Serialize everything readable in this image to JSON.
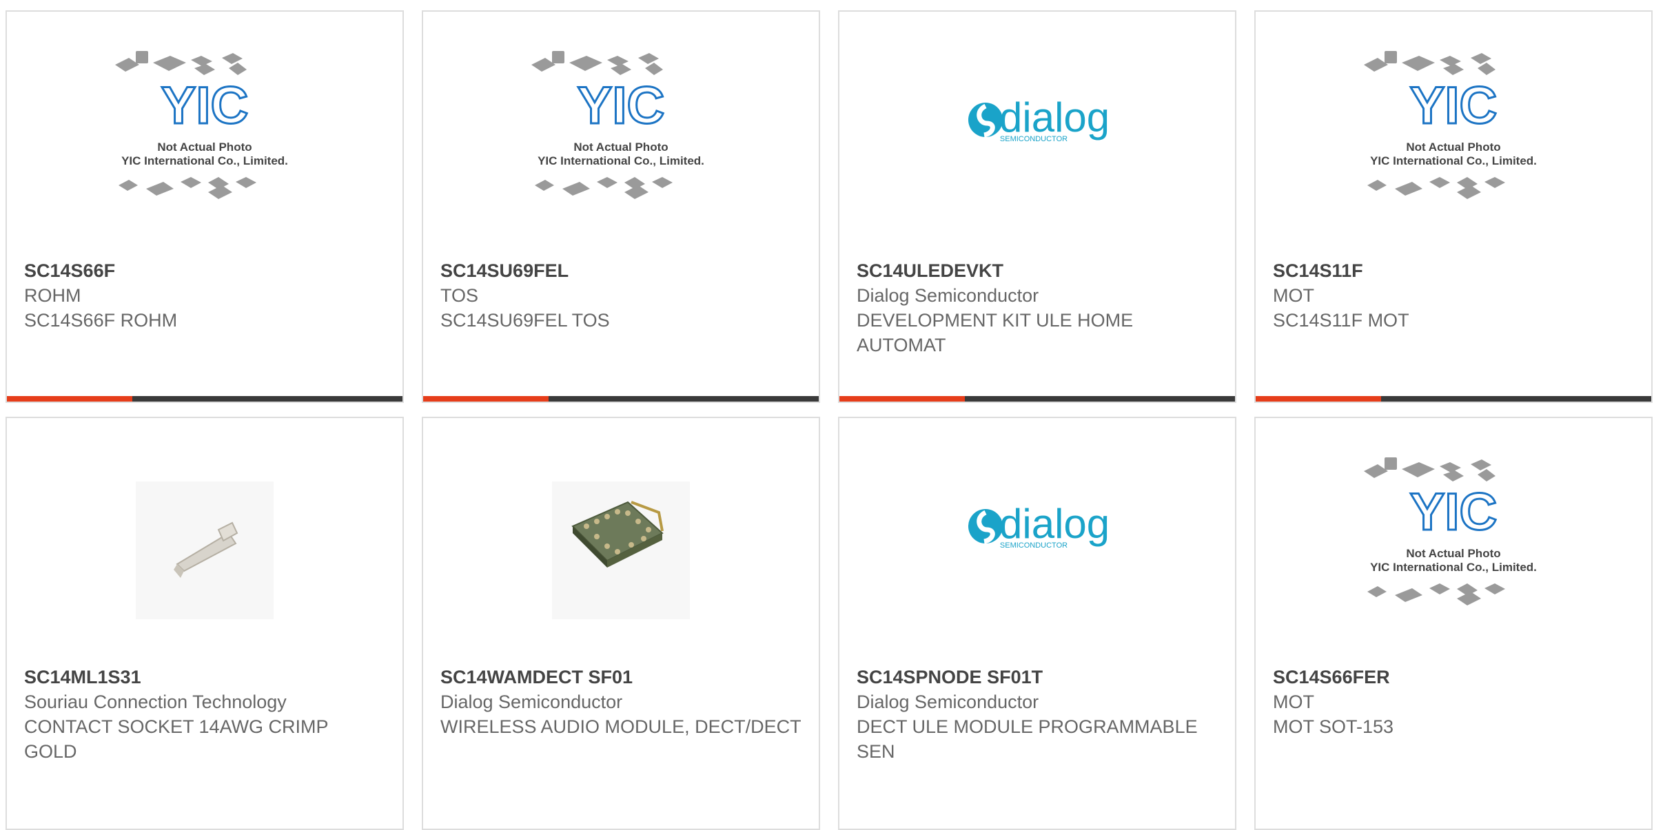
{
  "cards": [
    {
      "part": "SC14S66F",
      "maker": "ROHM",
      "desc": "SC14S66F ROHM",
      "image": "yic-placeholder-icon"
    },
    {
      "part": "SC14SU69FEL",
      "maker": "TOS",
      "desc": "SC14SU69FEL TOS",
      "image": "yic-placeholder-icon"
    },
    {
      "part": "SC14ULEDEVKT",
      "maker": "Dialog Semiconductor",
      "desc": "DEVELOPMENT KIT ULE HOME AUTOMAT",
      "image": "dialog-logo-icon"
    },
    {
      "part": "SC14S11F",
      "maker": "MOT",
      "desc": "SC14S11F MOT",
      "image": "yic-placeholder-icon"
    },
    {
      "part": "SC14ML1S31",
      "maker": "Souriau Connection Technology",
      "desc": "CONTACT SOCKET 14AWG CRIMP GOLD",
      "image": "contact-socket-icon"
    },
    {
      "part": "SC14WAMDECT SF01",
      "maker": "Dialog Semiconductor",
      "desc": "WIRELESS AUDIO MODULE, DECT/DECT",
      "image": "audio-module-icon"
    },
    {
      "part": "SC14SPNODE SF01T",
      "maker": "Dialog Semiconductor",
      "desc": "DECT ULE MODULE PROGRAMMABLE SEN",
      "image": "dialog-logo-icon"
    },
    {
      "part": "SC14S66FER",
      "maker": "MOT",
      "desc": "MOT SOT-153",
      "image": "yic-placeholder-icon"
    }
  ],
  "placeholder": {
    "brand": "YIC",
    "line1": "Not Actual Photo",
    "line2": "YIC International Co., Limited."
  },
  "dialog": {
    "brand": "dialog",
    "sub": "SEMICONDUCTOR"
  },
  "colors": {
    "accent": "#e63d1a",
    "bar": "#3a3a3a",
    "dialog_blue": "#1aa3c9",
    "yic_blue": "#1c74c4"
  }
}
